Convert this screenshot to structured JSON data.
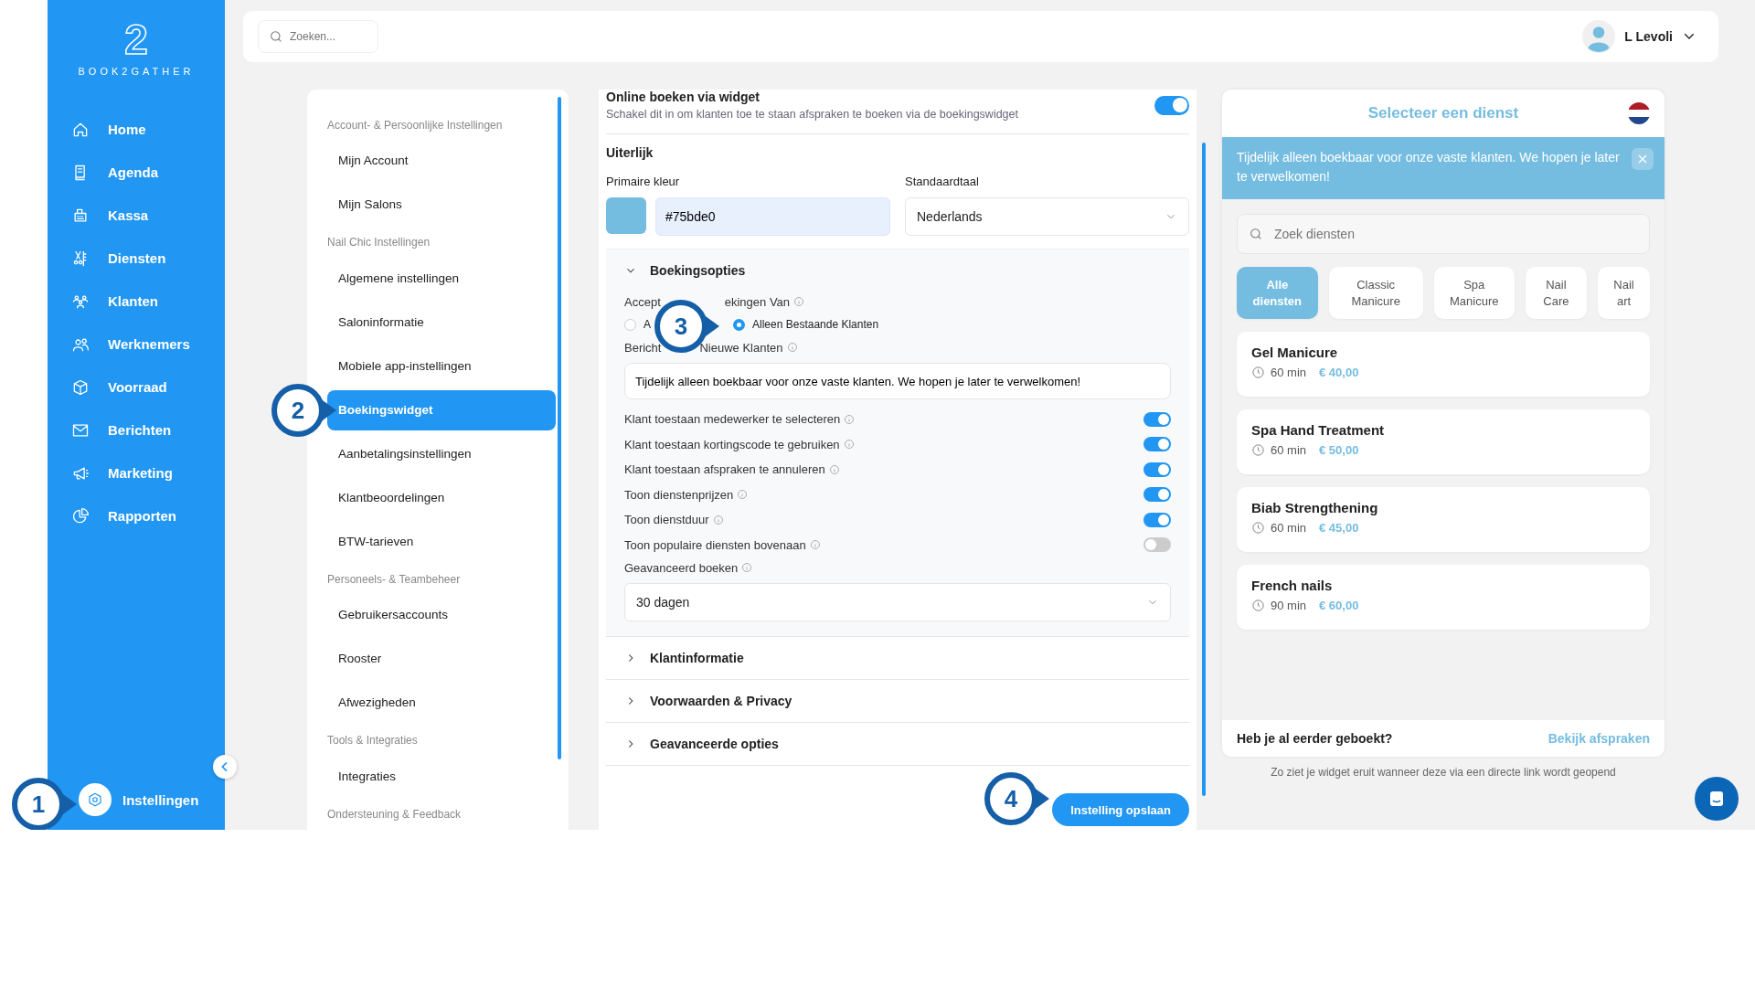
{
  "brand": {
    "mark": "2",
    "name": "BOOK2GATHER"
  },
  "nav": [
    {
      "label": "Home",
      "selected": false
    },
    {
      "label": "Agenda",
      "selected": false
    },
    {
      "label": "Kassa",
      "selected": false
    },
    {
      "label": "Diensten",
      "selected": false
    },
    {
      "label": "Klanten",
      "selected": false
    },
    {
      "label": "Werknemers",
      "selected": false
    },
    {
      "label": "Voorraad",
      "selected": false
    },
    {
      "label": "Berichten",
      "selected": false
    },
    {
      "label": "Marketing",
      "selected": false
    },
    {
      "label": "Rapporten",
      "selected": false
    }
  ],
  "settings_nav": {
    "label": "Instellingen",
    "selected": true
  },
  "search": {
    "placeholder": "Zoeken..."
  },
  "user": {
    "name": "L Levoli"
  },
  "settings_menu": [
    {
      "kind": "heading",
      "label": "Account- & Persoonlijke Instellingen"
    },
    {
      "kind": "item",
      "label": "Mijn Account",
      "selected": false
    },
    {
      "kind": "item",
      "label": "Mijn Salons",
      "selected": false
    },
    {
      "kind": "heading",
      "label": "Nail Chic Instellingen"
    },
    {
      "kind": "item",
      "label": "Algemene instellingen",
      "selected": false
    },
    {
      "kind": "item",
      "label": "Saloninformatie",
      "selected": false
    },
    {
      "kind": "item",
      "label": "Mobiele app-instellingen",
      "selected": false
    },
    {
      "kind": "item",
      "label": "Boekingswidget",
      "selected": true
    },
    {
      "kind": "item",
      "label": "Aanbetalingsinstellingen",
      "selected": false
    },
    {
      "kind": "item",
      "label": "Klantbeoordelingen",
      "selected": false
    },
    {
      "kind": "item",
      "label": "BTW-tarieven",
      "selected": false
    },
    {
      "kind": "heading",
      "label": "Personeels- & Teambeheer"
    },
    {
      "kind": "item",
      "label": "Gebruikersaccounts",
      "selected": false
    },
    {
      "kind": "item",
      "label": "Rooster",
      "selected": false
    },
    {
      "kind": "item",
      "label": "Afwezigheden",
      "selected": false
    },
    {
      "kind": "heading",
      "label": "Tools & Integraties"
    },
    {
      "kind": "item",
      "label": "Integraties",
      "selected": false
    },
    {
      "kind": "heading",
      "label": "Ondersteuning & Feedback"
    }
  ],
  "widget_settings": {
    "title": "Online boeken via widget",
    "description": "Schakel dit in om klanten toe te staan afspraken te boeken via de boekingswidget",
    "on": true,
    "appearance": {
      "heading": "Uiterlijk",
      "color_label": "Primaire kleur",
      "color_value": "#75bde0",
      "language_label": "Standaardtaal",
      "language_value": "Nederlands"
    },
    "booking_options": {
      "title": "Boekingsopties",
      "expanded": true,
      "accept_label": {
        "before": "Accept",
        "after": "ekingen Van"
      },
      "radios": [
        {
          "label": "A",
          "selected": false
        },
        {
          "label": "Alleen Bestaande Klanten",
          "selected": true
        }
      ],
      "message_label": {
        "before": "Bericht",
        "after": "Nieuwe Klanten"
      },
      "message_value": "Tijdelijk alleen boekbaar voor onze vaste klanten. We hopen je later te verwelkomen!",
      "toggles": [
        {
          "label": "Klant toestaan medewerker te selecteren",
          "on": true
        },
        {
          "label": "Klant toestaan kortingscode te gebruiken",
          "on": true
        },
        {
          "label": "Klant toestaan afspraken te annuleren",
          "on": true
        },
        {
          "label": "Toon dienstenprijzen",
          "on": true
        },
        {
          "label": "Toon dienstduur",
          "on": true
        },
        {
          "label": "Toon populaire diensten bovenaan",
          "on": false
        }
      ],
      "advance_label": "Geavanceerd boeken",
      "advance_value": "30 dagen"
    },
    "sections": [
      {
        "title": "Klantinformatie",
        "expanded": false
      },
      {
        "title": "Voorwaarden & Privacy",
        "expanded": false
      },
      {
        "title": "Geavanceerde opties",
        "expanded": false
      }
    ],
    "save_button": "Instelling opslaan"
  },
  "preview": {
    "title": "Selecteer een dienst",
    "banner": "Tijdelijk alleen boekbaar voor onze vaste klanten. We hopen je later te verwelkomen!",
    "search_placeholder": "Zoek diensten",
    "categories": [
      {
        "label": "Alle diensten",
        "selected": true
      },
      {
        "label": "Classic Manicure",
        "selected": false
      },
      {
        "label": "Spa Manicure",
        "selected": false
      },
      {
        "label": "Nail Care",
        "selected": false
      },
      {
        "label": "Nail art",
        "selected": false
      }
    ],
    "services": [
      {
        "name": "Gel Manicure",
        "duration": "60 min",
        "price": "€ 40,00"
      },
      {
        "name": "Spa Hand Treatment",
        "duration": "60 min",
        "price": "€ 50,00"
      },
      {
        "name": "Biab Strengthening",
        "duration": "60 min",
        "price": "€ 45,00"
      },
      {
        "name": "French nails",
        "duration": "90 min",
        "price": "€ 60,00"
      }
    ],
    "footer_question": "Heb je al eerder geboekt?",
    "footer_link": "Bekijk afspraken",
    "caption": "Zo ziet je widget eruit wanneer deze via een directe link wordt geopend"
  },
  "callouts": [
    {
      "number": "1"
    },
    {
      "number": "2"
    },
    {
      "number": "3"
    },
    {
      "number": "4"
    }
  ]
}
